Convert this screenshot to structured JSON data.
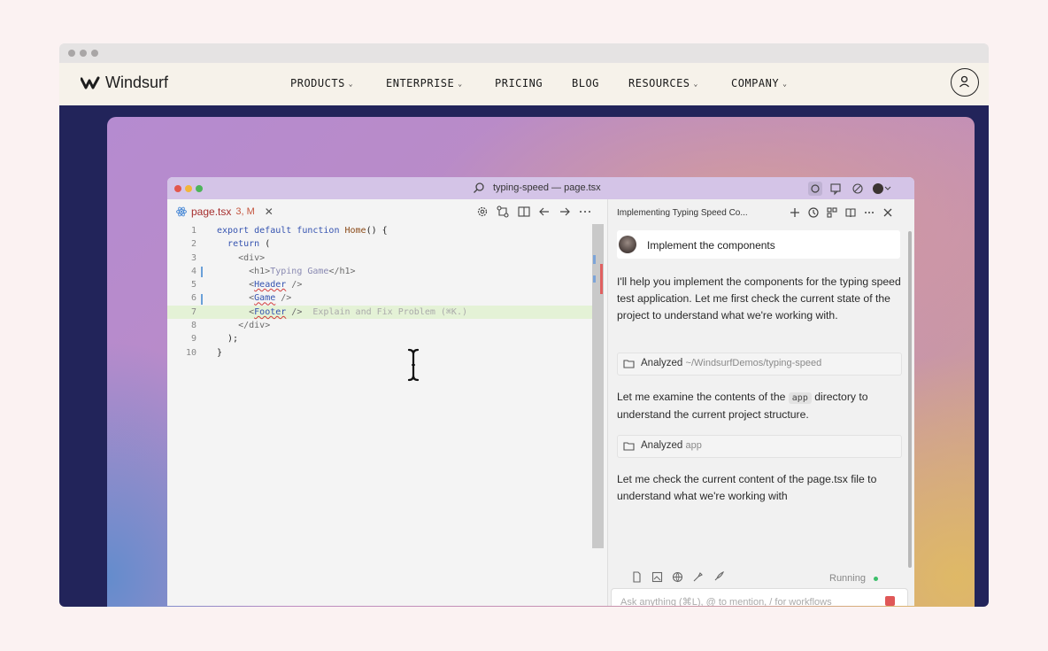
{
  "site": {
    "brand": "Windsurf",
    "nav": [
      {
        "label": "PRODUCTS",
        "dropdown": true
      },
      {
        "label": "ENTERPRISE",
        "dropdown": true
      },
      {
        "label": "PRICING",
        "dropdown": false
      },
      {
        "label": "BLOG",
        "dropdown": false
      },
      {
        "label": "RESOURCES",
        "dropdown": true
      },
      {
        "label": "COMPANY",
        "dropdown": true
      }
    ]
  },
  "ide": {
    "window_title": "typing-speed — page.tsx",
    "tab": {
      "filename": "page.tsx",
      "status": "3, M"
    },
    "code_lines": [
      {
        "n": "1",
        "text": "export default function Home() {"
      },
      {
        "n": "2",
        "text": "  return ("
      },
      {
        "n": "3",
        "text": "    <div>"
      },
      {
        "n": "4",
        "text": "      <h1>Typing Game</h1>"
      },
      {
        "n": "5",
        "text": "      <Header />"
      },
      {
        "n": "6",
        "text": "      <Game />"
      },
      {
        "n": "7",
        "text": "      <Footer />"
      },
      {
        "n": "8",
        "text": "    </div>"
      },
      {
        "n": "9",
        "text": "  );"
      },
      {
        "n": "10",
        "text": "}"
      }
    ],
    "inline_hint": "Explain and Fix Problem (⌘K.)",
    "chat": {
      "title": "Implementing Typing Speed Co...",
      "user_message": "Implement the components",
      "reply_1": "I'll help you implement the components for the typing speed test application. Let me first check the current state of the project to understand what we're working with.",
      "tool_1_label": "Analyzed",
      "tool_1_path": "~/WindsurfDemos/typing-speed",
      "reply_2_pre": "Let me examine the contents of the",
      "reply_2_code": "app",
      "reply_2_post": "directory to understand the current project structure.",
      "tool_2_label": "Analyzed",
      "tool_2_path": "app",
      "reply_3": "Let me check the current content of the page.tsx file to understand what we're working with",
      "status": "Running",
      "input_placeholder": "Ask anything (⌘L), @ to mention, / for workflows"
    }
  }
}
